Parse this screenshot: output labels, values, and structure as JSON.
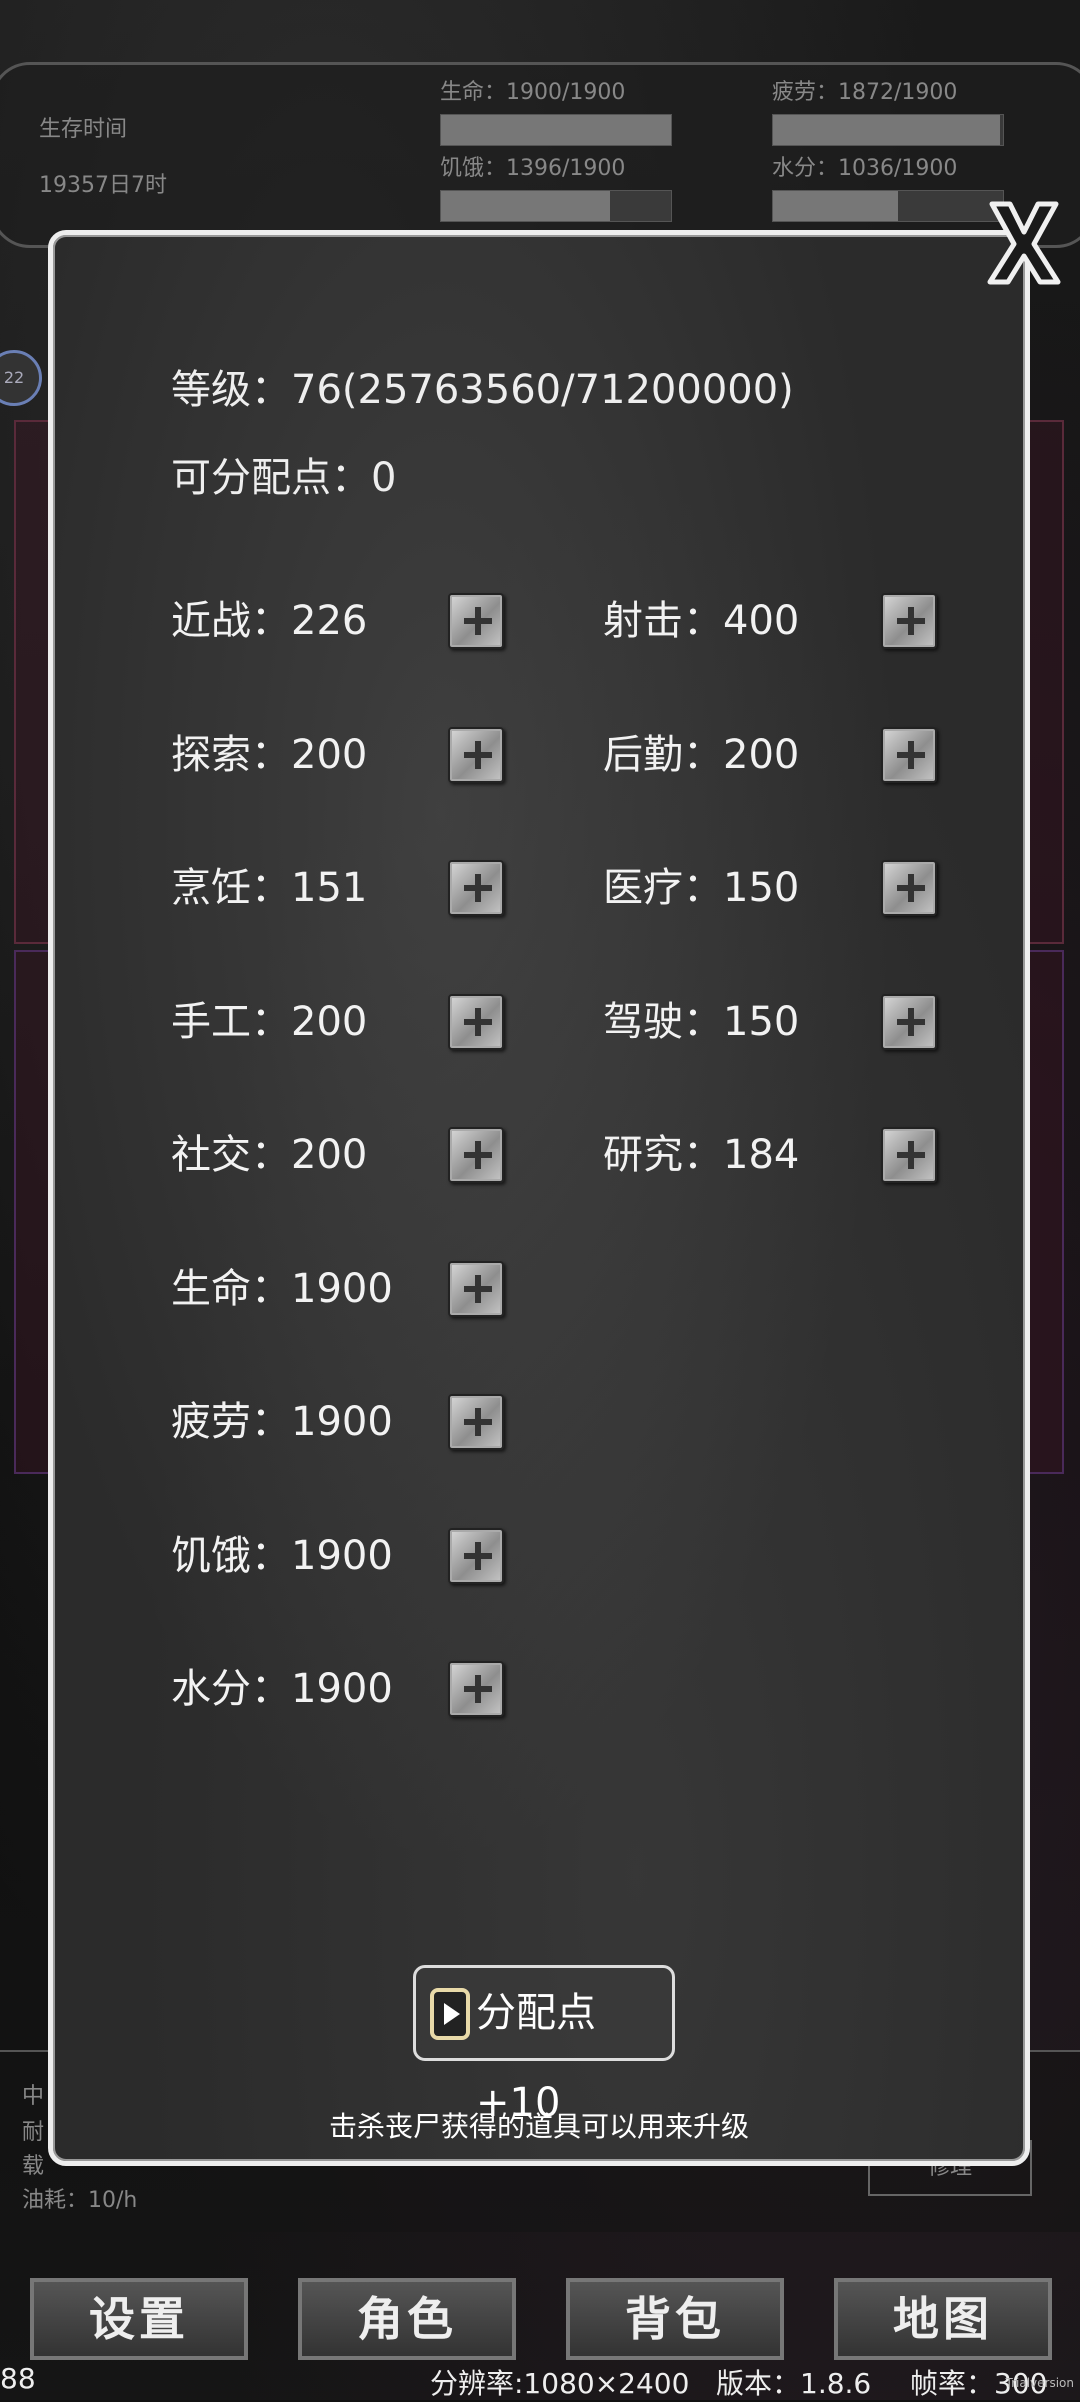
{
  "hud": {
    "survive_label": "生存时间",
    "survive_value": "19357日7时",
    "stats": [
      {
        "text": "生命：1900/1900",
        "fill": 1.0
      },
      {
        "text": "疲劳：1872/1900",
        "fill": 0.985
      },
      {
        "text": "饥饿：1396/1900",
        "fill": 0.735
      },
      {
        "text": "水分：1036/1900",
        "fill": 0.545
      }
    ]
  },
  "side": {
    "circle_text": "22"
  },
  "info": {
    "lines": [
      "中",
      "耐",
      "载"
    ],
    "fuel": "油耗：10/h",
    "repair": "修理"
  },
  "nav": {
    "settings": "设置",
    "character": "角色",
    "backpack": "背包",
    "map": "地图"
  },
  "footer": {
    "left": "88",
    "resolution": "分辨率:1080×2400",
    "version": "版本：1.8.6",
    "fps": "帧率：300",
    "mark": "Trialversion"
  },
  "modal": {
    "level": "等级：76(25763560/71200000)",
    "points": "可分配点：0",
    "attributes": [
      "近战：226",
      "射击：400",
      "探索：200",
      "后勤：200",
      "烹饪：151",
      "医疗：150",
      "手工：200",
      "驾驶：150",
      "社交：200",
      "研究：184",
      "生命：1900",
      "疲劳：1900",
      "饥饿：1900",
      "水分：1900"
    ],
    "ad_button": "分配点+10",
    "tip": "击杀丧尸获得的道具可以用来升级"
  }
}
